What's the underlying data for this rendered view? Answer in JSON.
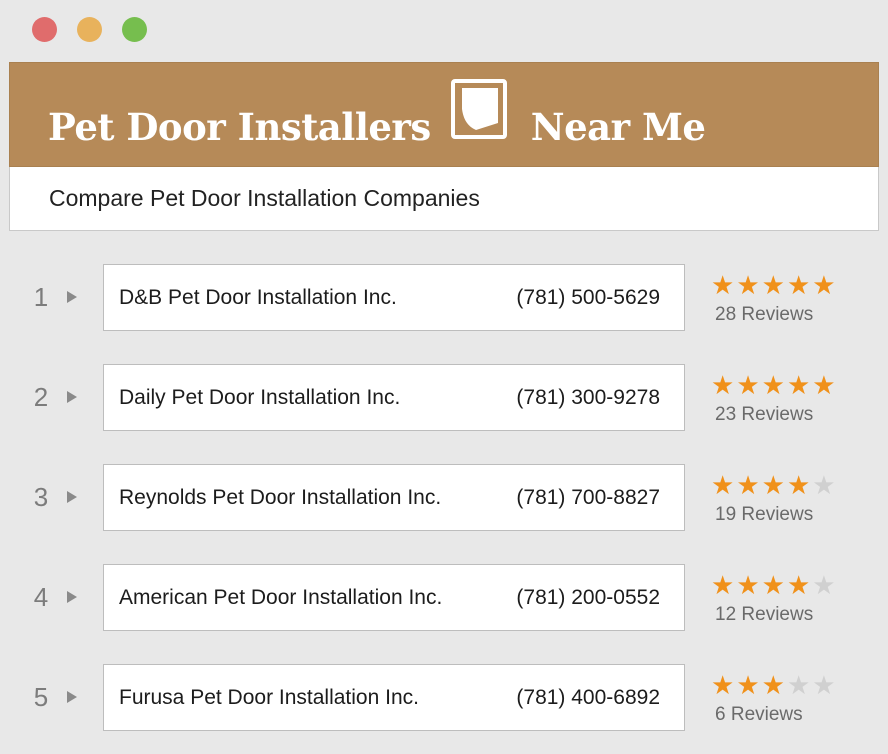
{
  "window": {
    "controls": [
      "close",
      "minimize",
      "maximize"
    ]
  },
  "header": {
    "title_left": "Pet Door Installers",
    "title_right": "Near Me",
    "icon": "pet-door-icon",
    "background": "#b68a58"
  },
  "subheader": {
    "text": "Compare Pet Door Installation Companies"
  },
  "companies": [
    {
      "rank": "1",
      "name": "D&B Pet Door Installation Inc.",
      "phone": "(781) 500-5629",
      "stars": 5,
      "reviews": "28 Reviews"
    },
    {
      "rank": "2",
      "name": "Daily Pet Door Installation Inc.",
      "phone": "(781) 300-9278",
      "stars": 5,
      "reviews": "23 Reviews"
    },
    {
      "rank": "3",
      "name": "Reynolds Pet Door Installation Inc.",
      "phone": "(781) 700-8827",
      "stars": 4,
      "reviews": "19 Reviews"
    },
    {
      "rank": "4",
      "name": "American Pet Door Installation Inc.",
      "phone": "(781) 200-0552",
      "stars": 4,
      "reviews": "12 Reviews"
    },
    {
      "rank": "5",
      "name": "Furusa Pet Door Installation Inc.",
      "phone": "(781) 400-6892",
      "stars": 3,
      "reviews": "6 Reviews"
    }
  ],
  "colors": {
    "star_on": "#f0911b",
    "star_off": "#d0d0d0"
  }
}
